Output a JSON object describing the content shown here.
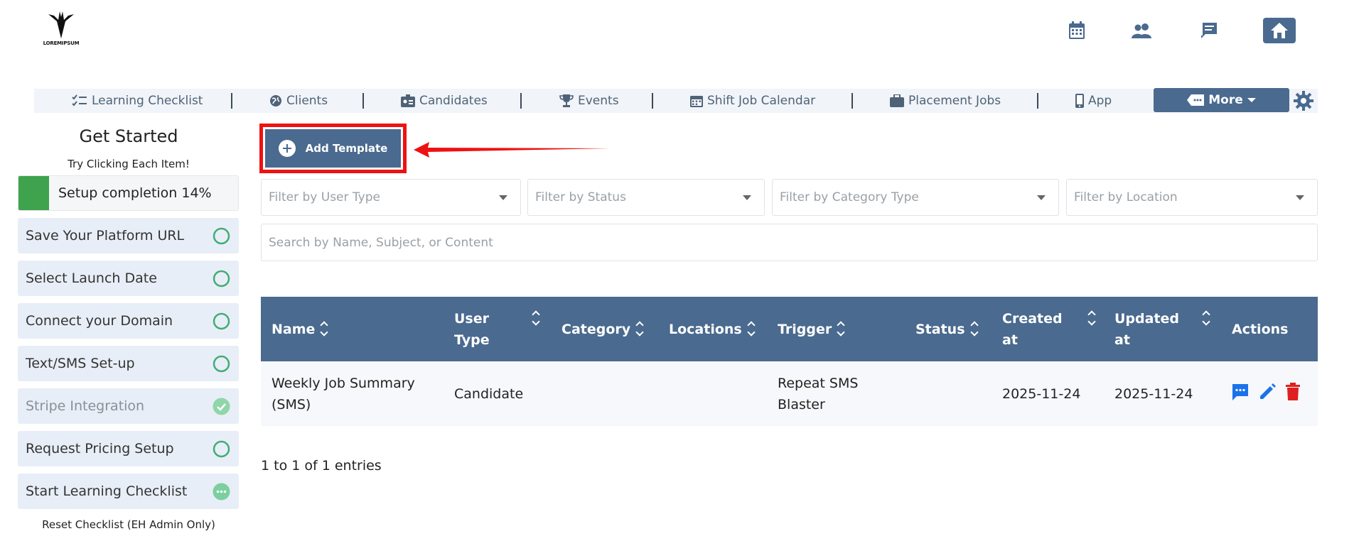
{
  "header": {
    "logo_text": "LOREMIPSUM",
    "icons": [
      "calendar-icon",
      "users-icon",
      "chat-icon",
      "home-icon"
    ]
  },
  "nav": {
    "items": [
      {
        "label": "Learning Checklist",
        "icon": "checklist-icon"
      },
      {
        "label": "Clients",
        "icon": "globe-icon"
      },
      {
        "label": "Candidates",
        "icon": "id-badge-icon"
      },
      {
        "label": "Events",
        "icon": "trophy-icon"
      },
      {
        "label": "Shift Job Calendar",
        "icon": "calendar-icon"
      },
      {
        "label": "Placement Jobs",
        "icon": "briefcase-icon"
      },
      {
        "label": "App",
        "icon": "phone-icon"
      }
    ],
    "more_label": "More"
  },
  "sidebar": {
    "title": "Get Started",
    "subtitle": "Try Clicking Each Item!",
    "progress_label": "Setup completion 14%",
    "progress_value": 0.14,
    "items": [
      {
        "label": "Save Your Platform URL",
        "status": "pending"
      },
      {
        "label": "Select Launch Date",
        "status": "pending"
      },
      {
        "label": "Connect your Domain",
        "status": "pending"
      },
      {
        "label": "Text/SMS Set-up",
        "status": "pending"
      },
      {
        "label": "Stripe Integration",
        "status": "done"
      },
      {
        "label": "Request Pricing Setup",
        "status": "pending"
      },
      {
        "label": "Start Learning Checklist",
        "status": "in-progress"
      }
    ],
    "reset_label": "Reset Checklist (EH Admin Only)"
  },
  "main": {
    "add_button_label": "Add Template",
    "filters": [
      "Filter by User Type",
      "Filter by Status",
      "Filter by Category Type",
      "Filter by Location"
    ],
    "search_placeholder": "Search by Name, Subject, or Content",
    "table": {
      "columns": [
        "Name",
        "User Type",
        "Category",
        "Locations",
        "Trigger",
        "Status",
        "Created at",
        "Updated at",
        "Actions"
      ],
      "rows": [
        {
          "name": "Weekly Job Summary (SMS)",
          "user_type": "Candidate",
          "category": "",
          "locations": "",
          "trigger": "Repeat SMS Blaster",
          "status": "",
          "created_at": "2025-11-24",
          "updated_at": "2025-11-24"
        }
      ]
    },
    "entries_text": "1 to 1 of 1 entries"
  },
  "colors": {
    "primary": "#4a6a8f",
    "success": "#3fa34d",
    "highlight": "#ee1111",
    "action_blue": "#1a73e8",
    "delete_red": "#e02020"
  }
}
